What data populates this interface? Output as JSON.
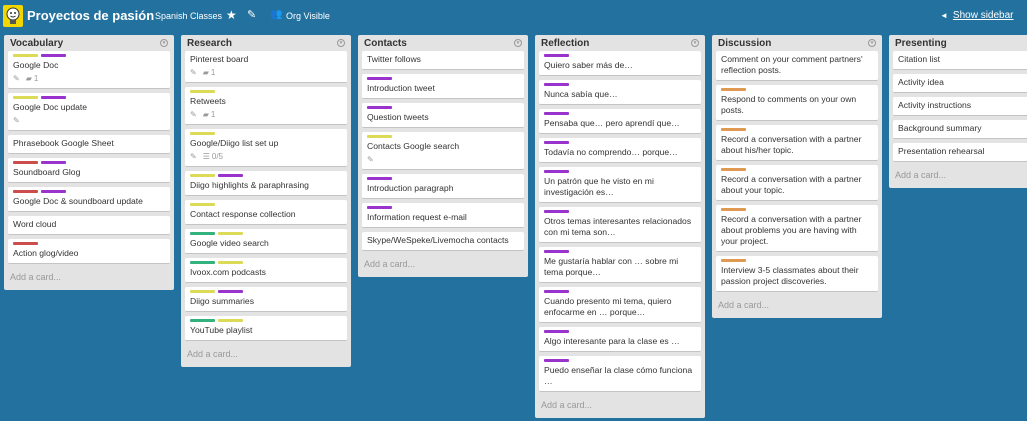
{
  "board": {
    "title": "Proyectos de pasión",
    "org": "Spanish Classes",
    "visibility": "Org Visible",
    "show_sidebar": "Show sidebar"
  },
  "label_colors": {
    "green": "#34b27d",
    "yellow": "#dbdb57",
    "orange": "#e09952",
    "red": "#cb4d4d",
    "purple": "#9933cc",
    "blue": "#4d77cb"
  },
  "add_card": "Add a card...",
  "lists": [
    {
      "name": "Vocabulary",
      "cards": [
        {
          "title": "Google Doc",
          "labels": [
            "yellow",
            "purple"
          ],
          "badges": {
            "edit": true,
            "comments": "1"
          }
        },
        {
          "title": "Google Doc update",
          "labels": [
            "yellow",
            "purple"
          ],
          "badges": {
            "edit": true
          }
        },
        {
          "title": "Phrasebook Google Sheet",
          "labels": []
        },
        {
          "title": "Soundboard Glog",
          "labels": [
            "red",
            "purple"
          ]
        },
        {
          "title": "Google Doc & soundboard update",
          "labels": [
            "red",
            "purple"
          ]
        },
        {
          "title": "Word cloud",
          "labels": []
        },
        {
          "title": "Action glog/video",
          "labels": [
            "red"
          ]
        }
      ]
    },
    {
      "name": "Research",
      "cards": [
        {
          "title": "Pinterest board",
          "labels": [],
          "badges": {
            "edit": true,
            "comments": "1"
          }
        },
        {
          "title": "Retweets",
          "labels": [
            "yellow"
          ],
          "badges": {
            "edit": true,
            "comments": "1"
          }
        },
        {
          "title": "Google/Diigo list set up",
          "labels": [
            "yellow"
          ],
          "badges": {
            "edit": true,
            "checklist": "0/5"
          }
        },
        {
          "title": "Diigo highlights & paraphrasing",
          "labels": [
            "yellow",
            "purple"
          ]
        },
        {
          "title": "Contact response collection",
          "labels": [
            "yellow"
          ]
        },
        {
          "title": "Google video search",
          "labels": [
            "green",
            "yellow"
          ]
        },
        {
          "title": "Ivoox.com podcasts",
          "labels": [
            "green",
            "yellow"
          ]
        },
        {
          "title": "Diigo summaries",
          "labels": [
            "yellow",
            "purple"
          ]
        },
        {
          "title": "YouTube playlist",
          "labels": [
            "green",
            "yellow"
          ]
        }
      ]
    },
    {
      "name": "Contacts",
      "cards": [
        {
          "title": "Twitter follows",
          "labels": []
        },
        {
          "title": "Introduction tweet",
          "labels": [
            "purple"
          ]
        },
        {
          "title": "Question tweets",
          "labels": [
            "purple"
          ]
        },
        {
          "title": "Contacts Google search",
          "labels": [
            "yellow"
          ],
          "badges": {
            "edit": true
          }
        },
        {
          "title": "Introduction paragraph",
          "labels": [
            "purple"
          ]
        },
        {
          "title": "Information request e-mail",
          "labels": [
            "purple"
          ]
        },
        {
          "title": "Skype/WeSpeke/Livemocha contacts",
          "labels": []
        }
      ]
    },
    {
      "name": "Reflection",
      "cards": [
        {
          "title": "Quiero saber más de…",
          "labels": [
            "purple"
          ]
        },
        {
          "title": "Nunca sabía que…",
          "labels": [
            "purple"
          ]
        },
        {
          "title": "Pensaba que… pero aprendí que…",
          "labels": [
            "purple"
          ]
        },
        {
          "title": "Todavía no comprendo… porque…",
          "labels": [
            "purple"
          ]
        },
        {
          "title": "Un patrón que he visto en mi investigación es…",
          "labels": [
            "purple"
          ]
        },
        {
          "title": "Otros temas interesantes relacionados con mi tema son…",
          "labels": [
            "purple"
          ]
        },
        {
          "title": "Me gustaría hablar con … sobre mi tema porque…",
          "labels": [
            "purple"
          ]
        },
        {
          "title": "Cuando presento mi tema, quiero enfocarme en … porque…",
          "labels": [
            "purple"
          ]
        },
        {
          "title": "Algo interesante para la clase es …",
          "labels": [
            "purple"
          ]
        },
        {
          "title": "Puedo enseñar la clase cómo funciona …",
          "labels": [
            "purple"
          ]
        }
      ]
    },
    {
      "name": "Discussion",
      "cards": [
        {
          "title": "Comment on your comment partners' reflection posts.",
          "labels": []
        },
        {
          "title": "Respond to comments on your own posts.",
          "labels": [
            "orange"
          ]
        },
        {
          "title": "Record a conversation with a partner about his/her topic.",
          "labels": [
            "orange"
          ]
        },
        {
          "title": "Record a conversation with a partner about your topic.",
          "labels": [
            "orange"
          ]
        },
        {
          "title": "Record a conversation with a partner about problems you are having with your project.",
          "labels": [
            "orange"
          ]
        },
        {
          "title": "Interview 3-5 classmates about their passion project discoveries.",
          "labels": [
            "orange"
          ]
        }
      ]
    },
    {
      "name": "Presenting",
      "cards": [
        {
          "title": "Citation list",
          "labels": []
        },
        {
          "title": "Activity idea",
          "labels": []
        },
        {
          "title": "Activity instructions",
          "labels": []
        },
        {
          "title": "Background summary",
          "labels": []
        },
        {
          "title": "Presentation rehearsal",
          "labels": []
        }
      ]
    }
  ]
}
